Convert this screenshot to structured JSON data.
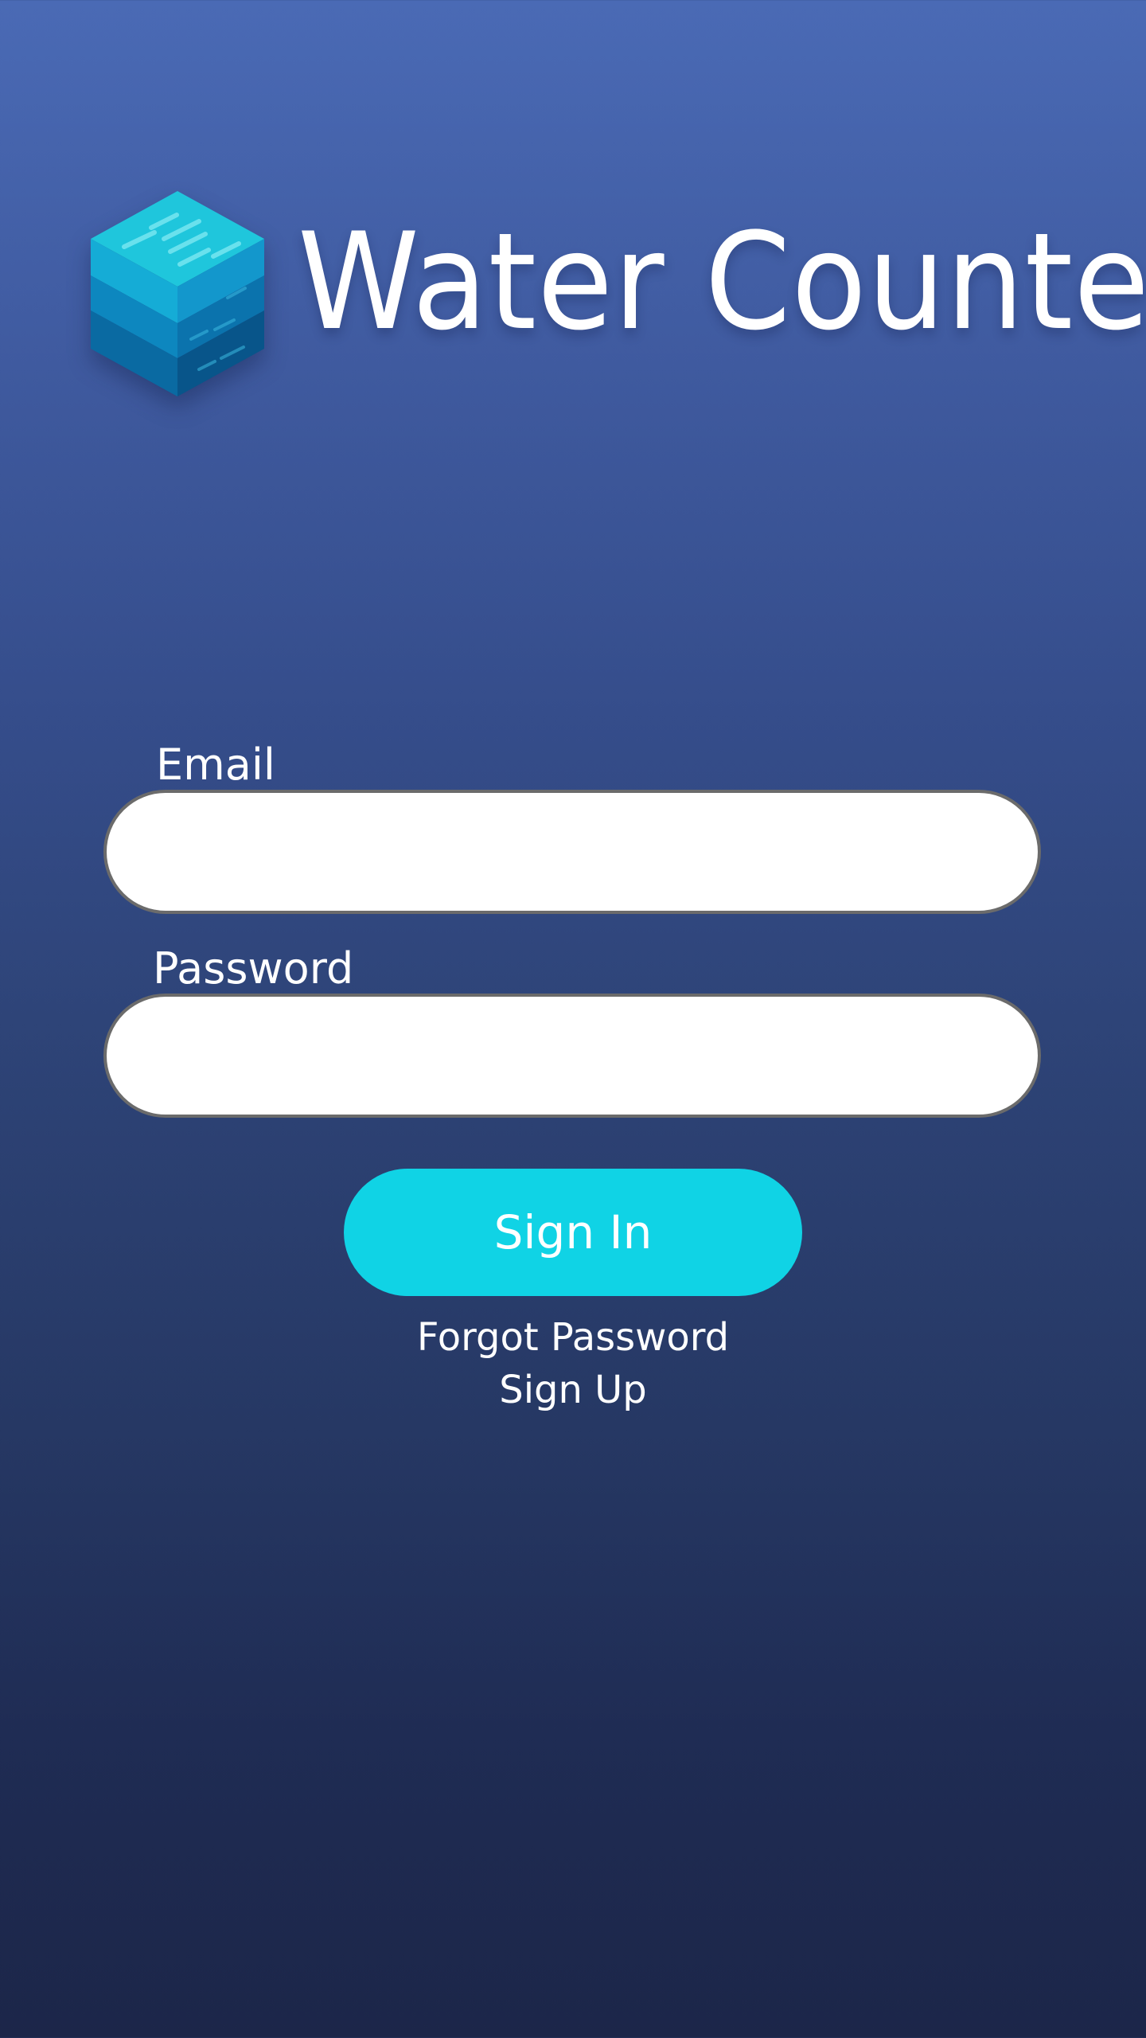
{
  "app": {
    "title": "Water Counter",
    "logo_icon": "water-cube-icon"
  },
  "form": {
    "email_label": "Email",
    "email_value": "",
    "email_placeholder": "",
    "password_label": "Password",
    "password_value": "",
    "password_placeholder": "",
    "signin_label": "Sign In",
    "forgot_password_label": "Forgot Password",
    "signup_label": "Sign Up"
  },
  "colors": {
    "background_top": "#4a6ab5",
    "background_bottom": "#1c2649",
    "accent": "#10d3e5",
    "input_background": "#ffffff",
    "input_border": "#6b6b6b"
  }
}
